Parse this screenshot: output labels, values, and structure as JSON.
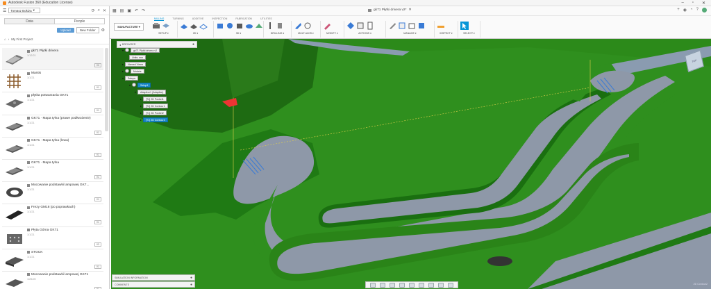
{
  "app": {
    "title": "Autodesk Fusion 360 (Education License)"
  },
  "window_controls": [
    "–",
    "▫",
    "✕"
  ],
  "left_panel": {
    "team": "Tomasz Bokiza",
    "tabs": [
      "Data",
      "People"
    ],
    "upload_label": "Upload",
    "new_folder_label": "New Folder",
    "breadcrumb": "My First Project",
    "files": [
      {
        "name": "gk71 Płytki drivera",
        "date": "1/12/21",
        "version": "V3"
      },
      {
        "name": "Mantis",
        "date": "1/1/21",
        "version": "V1"
      },
      {
        "name": "płytka potwarzania GK71",
        "date": "1/1/21",
        "version": "V1"
      },
      {
        "name": "GK71 · Mapa tylna (prawe podłwożenie)",
        "date": "1/1/21",
        "version": "V1"
      },
      {
        "name": "GK71 · Mapa tylna (lewa)",
        "date": "1/1/21",
        "version": "V1"
      },
      {
        "name": "GK71 · Mapa tylna",
        "date": "1/1/21",
        "version": "V1"
      },
      {
        "name": "Mocowanie podstawki lampowej GK7...",
        "date": "1/1/21",
        "version": "V1"
      },
      {
        "name": "Frezy GM18 (po poprawkach)",
        "date": "1/1/21",
        "version": "V1"
      },
      {
        "name": "Płyta Górna GK71",
        "date": "1/1/21",
        "version": "V3"
      },
      {
        "name": "STOCK",
        "date": "1/1/21",
        "version": "V1"
      },
      {
        "name": "Mocowanie podstawki lampowej GK71",
        "date": "1/25/20",
        "version": "V1"
      }
    ]
  },
  "toolbar": {
    "doc_title": "gk71 Płytki drivera v2*",
    "workspace": "MANUFACTURE ▾",
    "tabs": [
      "MILLING",
      "TURNING",
      "ADDITIVE",
      "INSPECTION",
      "FABRICATION",
      "UTILITIES"
    ],
    "groups": [
      "SETUP ▾",
      "2D ▾",
      "3D ▾",
      "DRILLING ▾",
      "MULTI-AXIS ▾",
      "MODIFY ▾",
      "ACTIONS ▾",
      "MANAGE ▾",
      "INSPECT ▾",
      "SELECT ▾"
    ]
  },
  "browser": {
    "label": "BROWSER",
    "tree": {
      "root": "gk71 Płytki drivera v2",
      "units": "Units: mm",
      "named_views": "Named Views",
      "models": "Models",
      "setups": "Setups",
      "setup1": "Setup1",
      "adaptive": "Adaptive1 (Adaptive)",
      "op1": "[T4] 2D Pocket1",
      "op2": "[T4] 2D Contour1",
      "op3": "[T1] 2D Pocket2",
      "op4": "[T1] 2D Contour2"
    }
  },
  "viewcube_label": "TOP",
  "bottom_panels": {
    "simulation": "SIMULATION INFORMATION",
    "comments": "COMMENTS"
  },
  "corner_label": "2D Contour2",
  "colors": {
    "model_green": "#2f8f1e",
    "selection_blue": "#1a88c7",
    "accent": "#0696d7"
  }
}
